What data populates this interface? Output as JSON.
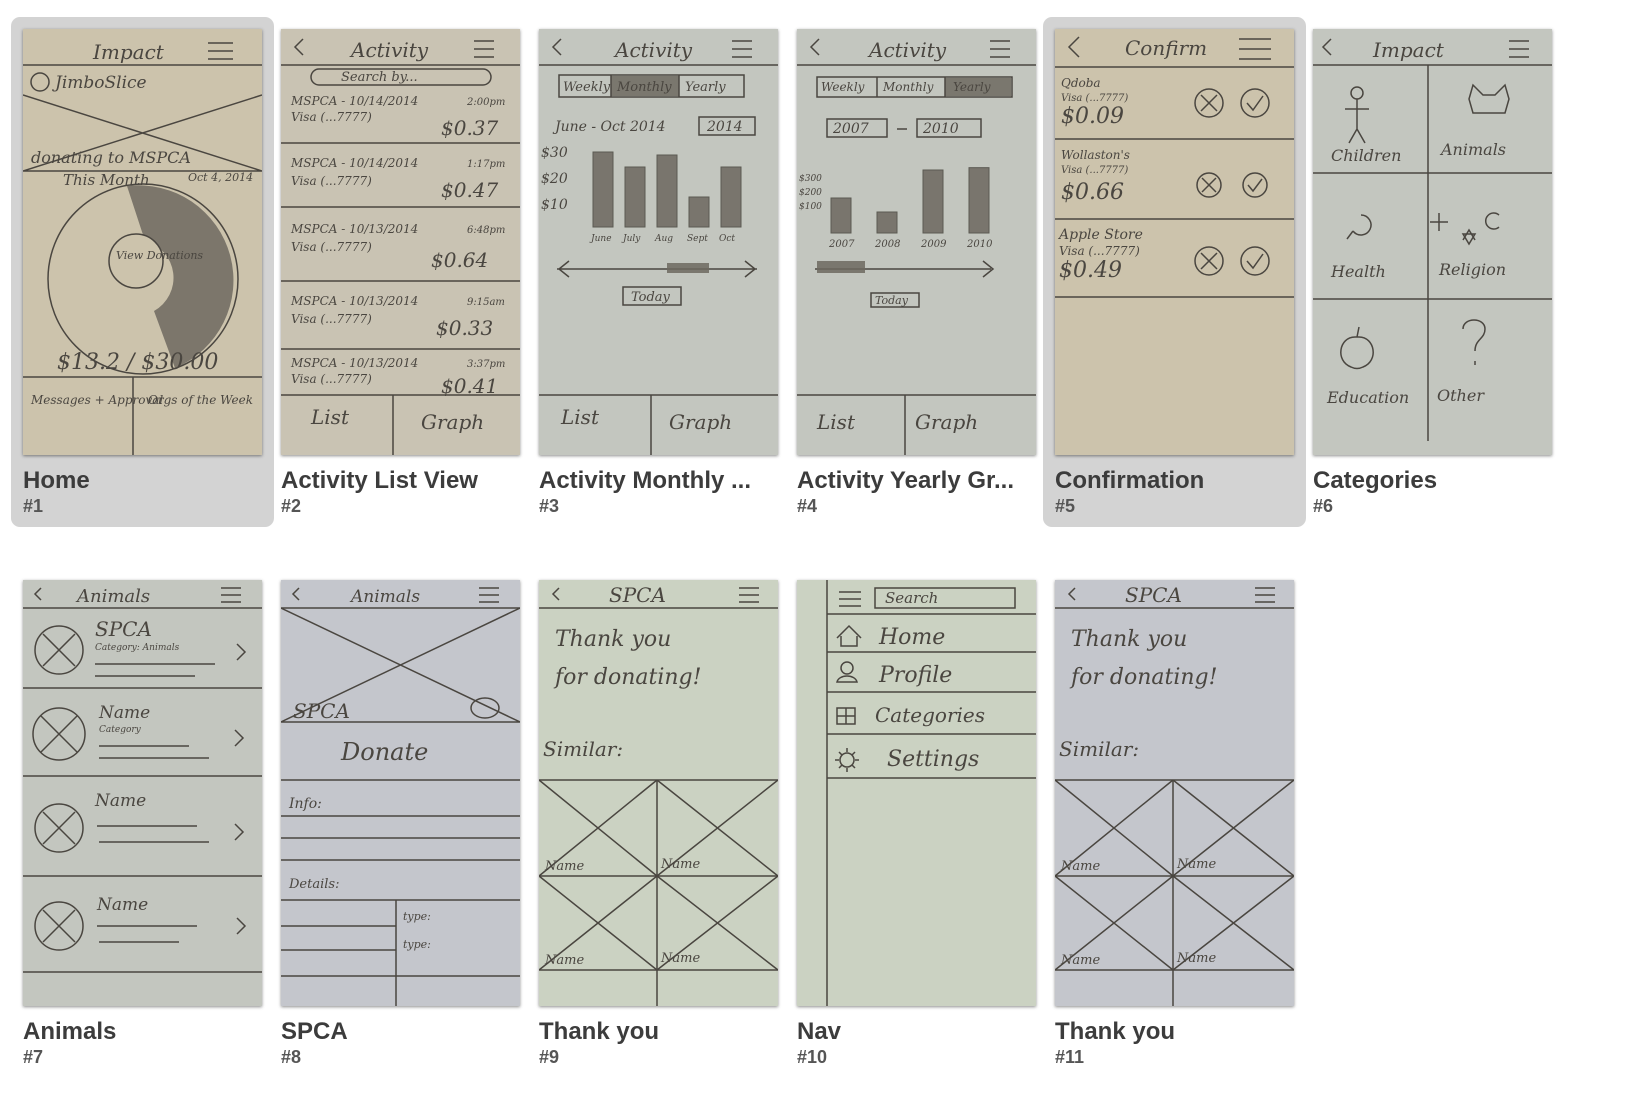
{
  "screens": [
    {
      "title": "Home",
      "number": "#1",
      "selected": true,
      "sketch": {
        "header": "Impact",
        "user": "JimboSlice",
        "donating": "donating to MSPCA",
        "this_month": "This Month",
        "date": "Oct 4, 2014",
        "center": "View Donations",
        "total": "$13.2 / $30.00",
        "left_tab": "Messages + Approval",
        "right_tab": "Orgs of the Week"
      }
    },
    {
      "title": "Activity List View",
      "number": "#2",
      "selected": false,
      "sketch": {
        "header": "Activity",
        "search": "Search by...",
        "rows": [
          {
            "org": "MSPCA - 10/14/2014",
            "card": "Visa (...7777)",
            "time": "2:00pm",
            "amount": "$0.37"
          },
          {
            "org": "MSPCA - 10/14/2014",
            "card": "Visa (...7777)",
            "time": "1:17pm",
            "amount": "$0.47"
          },
          {
            "org": "MSPCA - 10/13/2014",
            "card": "Visa (...7777)",
            "time": "6:48pm",
            "amount": "$0.64"
          },
          {
            "org": "MSPCA - 10/13/2014",
            "card": "Visa (...7777)",
            "time": "9:15am",
            "amount": "$0.33"
          },
          {
            "org": "MSPCA - 10/13/2014",
            "card": "Visa (...7777)",
            "time": "3:37pm",
            "amount": "$0.41"
          }
        ],
        "left_tab": "List",
        "right_tab": "Graph"
      }
    },
    {
      "title": "Activity Monthly ...",
      "number": "#3",
      "selected": false,
      "sketch": {
        "header": "Activity",
        "toggles": [
          "Weekly",
          "Monthly",
          "Yearly"
        ],
        "range": "June - Oct 2014",
        "year": "2014",
        "y_ticks": [
          "$30",
          "$20",
          "$10"
        ],
        "bars": [
          25,
          20,
          24,
          10,
          20
        ],
        "x_ticks": [
          "June",
          "July",
          "Aug",
          "Sept",
          "Oct"
        ],
        "today": "Today",
        "left_tab": "List",
        "right_tab": "Graph"
      }
    },
    {
      "title": "Activity Yearly Gr...",
      "number": "#4",
      "selected": false,
      "sketch": {
        "header": "Activity",
        "toggles": [
          "Weekly",
          "Monthly",
          "Yearly"
        ],
        "from": "2007",
        "to": "2010",
        "y_ticks": [
          "$300",
          "$200",
          "$100"
        ],
        "bars": [
          150,
          90,
          270,
          280
        ],
        "x_ticks": [
          "2007",
          "2008",
          "2009",
          "2010"
        ],
        "today": "Today",
        "left_tab": "List",
        "right_tab": "Graph"
      }
    },
    {
      "title": "Confirmation",
      "number": "#5",
      "selected": true,
      "sketch": {
        "header": "Confirm",
        "rows": [
          {
            "org": "Qdoba",
            "card": "Visa (...7777)",
            "amount": "$0.09"
          },
          {
            "org": "Wollaston's",
            "card": "Visa (...7777)",
            "amount": "$0.66"
          },
          {
            "org": "Apple Store",
            "card": "Visa (...7777)",
            "amount": "$0.49"
          }
        ]
      }
    },
    {
      "title": "Categories",
      "number": "#6",
      "selected": false,
      "sketch": {
        "header": "Impact",
        "cells": [
          "Children",
          "Animals",
          "Health",
          "Religion",
          "Education",
          "Other"
        ]
      }
    },
    {
      "title": "Animals",
      "number": "#7",
      "selected": false,
      "sketch": {
        "header": "Animals",
        "rows": [
          {
            "name": "SPCA",
            "sub": "Category: Animals"
          },
          {
            "name": "Name",
            "sub": "Category"
          },
          {
            "name": "Name",
            "sub": ""
          },
          {
            "name": "Name",
            "sub": ""
          }
        ]
      }
    },
    {
      "title": "SPCA",
      "number": "#8",
      "selected": false,
      "sketch": {
        "header": "Animals",
        "org": "SPCA",
        "button": "Donate",
        "info": "Info:",
        "details": "Details:",
        "type1": "type:",
        "type2": "type:"
      }
    },
    {
      "title": "Thank you",
      "number": "#9",
      "selected": false,
      "sketch": {
        "header": "SPCA",
        "line1": "Thank you",
        "line2": "for donating!",
        "similar": "Similar:",
        "names": [
          "Name",
          "Name",
          "Name",
          "Name"
        ]
      }
    },
    {
      "title": "Nav",
      "number": "#10",
      "selected": false,
      "sketch": {
        "search": "Search",
        "items": [
          "Home",
          "Profile",
          "Categories",
          "Settings"
        ]
      }
    },
    {
      "title": "Thank you",
      "number": "#11",
      "selected": false,
      "sketch": {
        "header": "SPCA",
        "line1": "Thank you",
        "line2": "for donating!",
        "similar": "Similar:",
        "names": [
          "Name",
          "Name",
          "Name",
          "Name"
        ]
      }
    }
  ]
}
